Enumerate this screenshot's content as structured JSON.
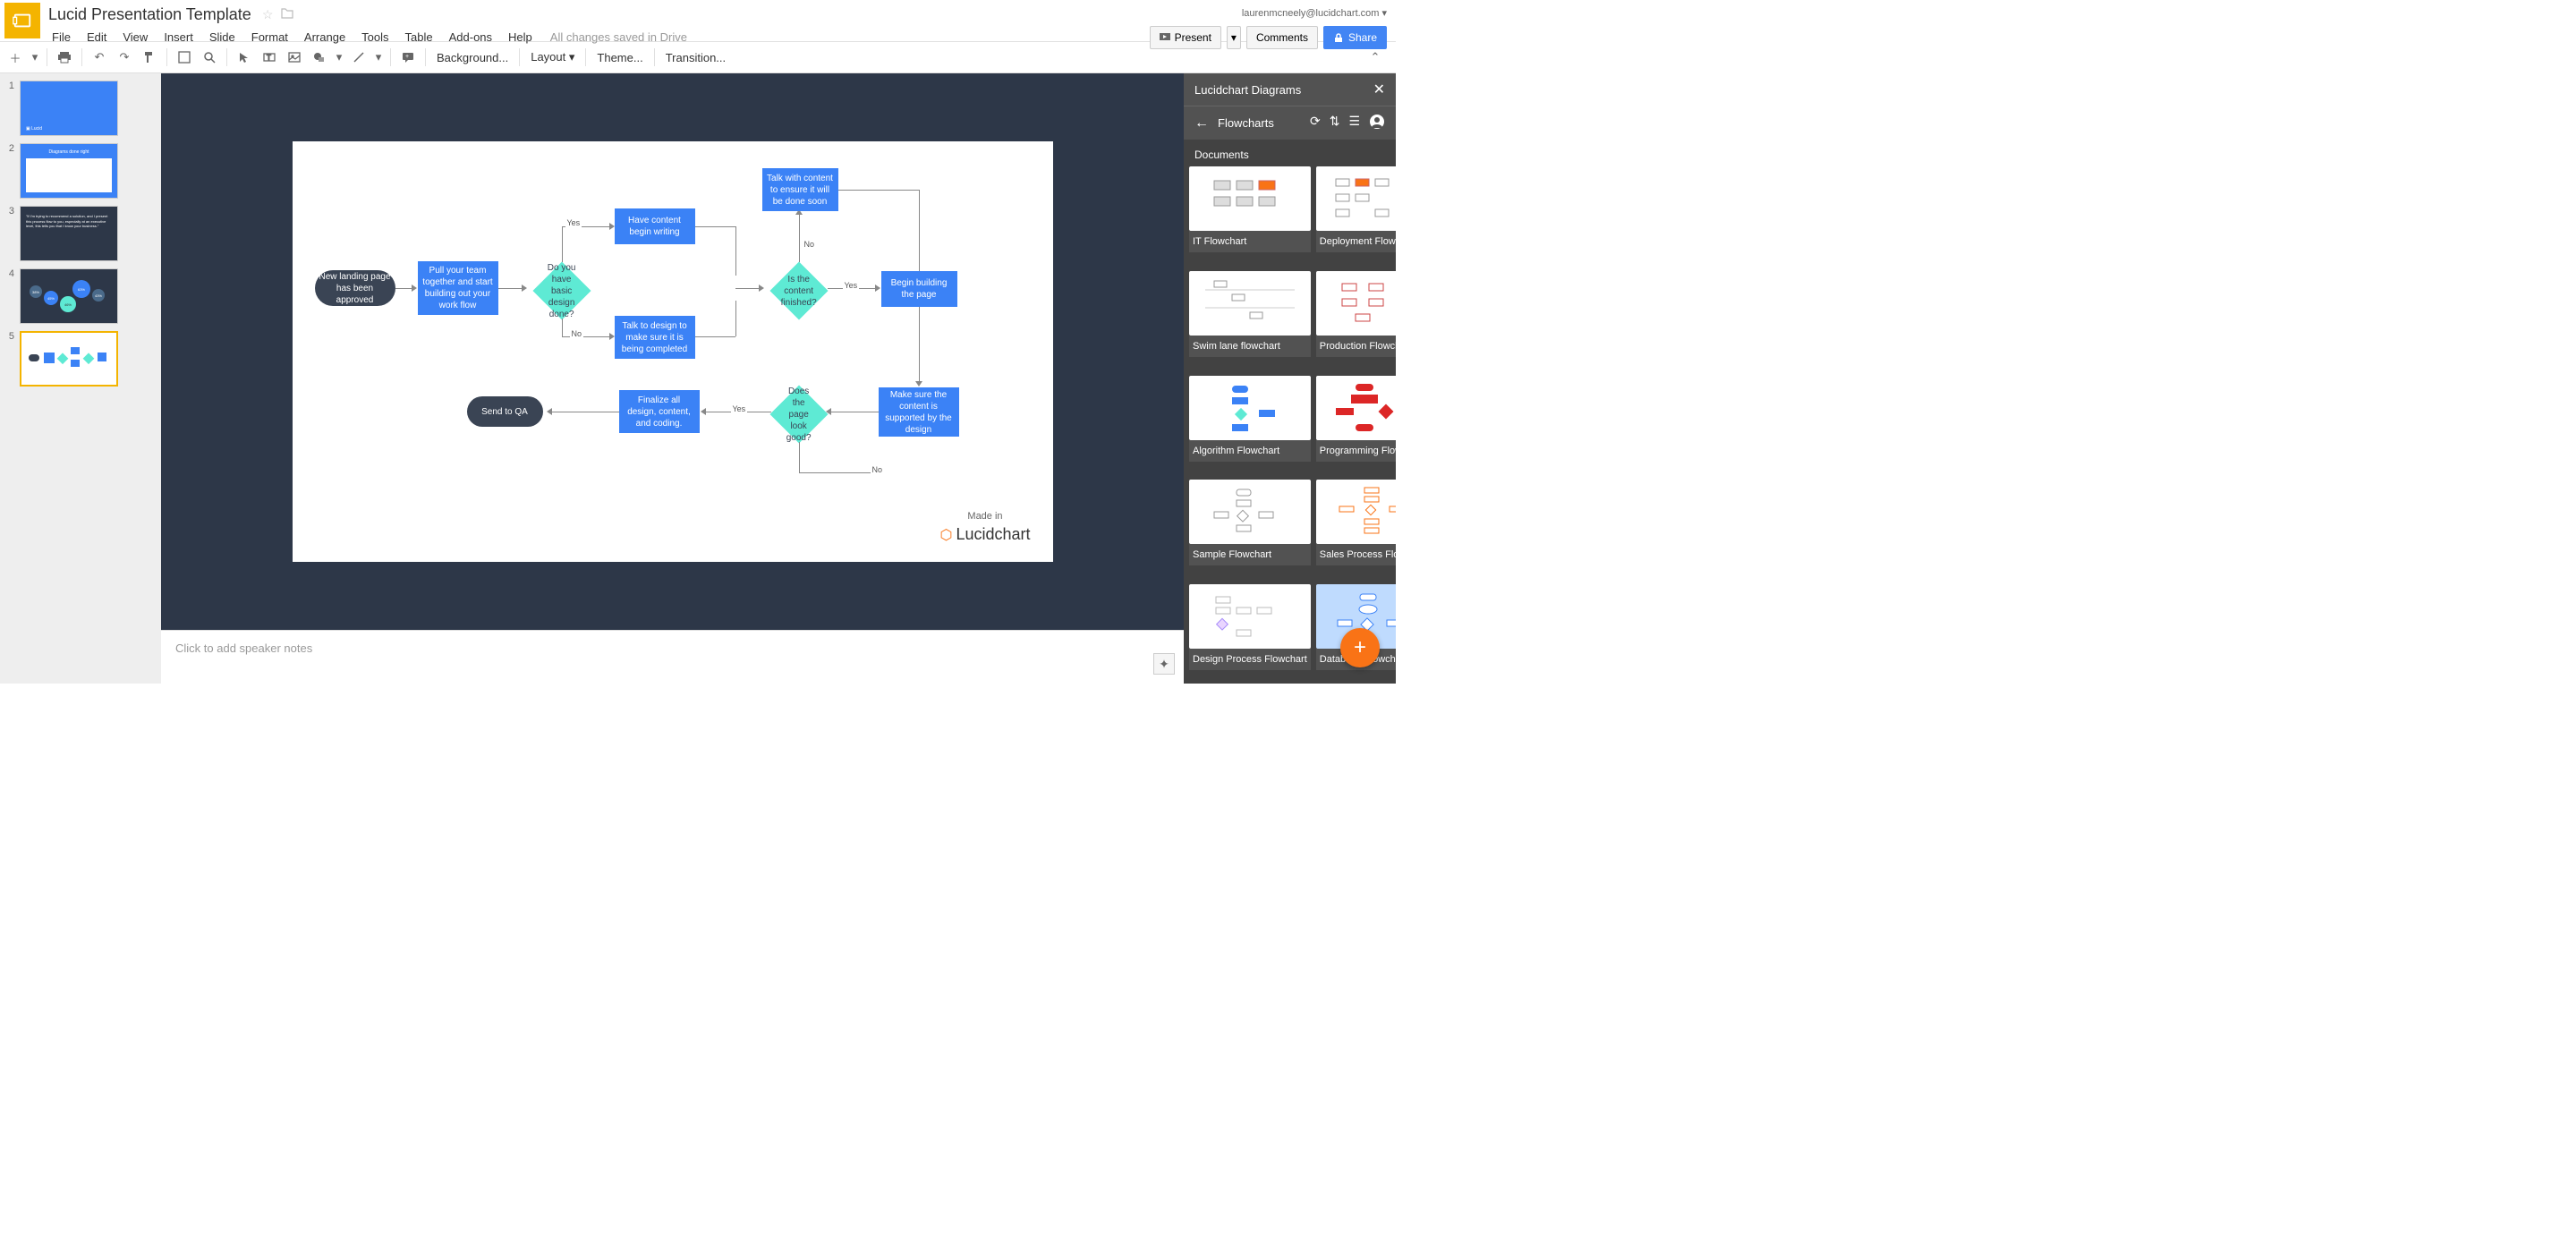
{
  "header": {
    "doc_title": "Lucid Presentation Template",
    "user_email": "laurenmcneely@lucidchart.com",
    "menus": [
      "File",
      "Edit",
      "View",
      "Insert",
      "Slide",
      "Format",
      "Arrange",
      "Tools",
      "Table",
      "Add-ons",
      "Help"
    ],
    "save_status": "All changes saved in Drive",
    "present_label": "Present",
    "comments_label": "Comments",
    "share_label": "Share"
  },
  "toolbar": {
    "background": "Background...",
    "layout": "Layout",
    "theme": "Theme...",
    "transition": "Transition..."
  },
  "slides": {
    "count": 5,
    "selected": 5,
    "thumb2_title": "Diagrams done right",
    "thumb3_quote": "\"If I'm trying to recommend a solution, and I present this process flow to you, especially at an executive level, this tells you that I know your business.\""
  },
  "flowchart": {
    "start": "New landing page has been approved",
    "pull_team": "Pull your team together and start building out your work flow",
    "basic_design": "Do you have basic design done?",
    "begin_writing": "Have content begin writing",
    "talk_design": "Talk to design to make sure it is being completed",
    "talk_content": "Talk with content to ensure it will be done soon",
    "content_finished": "Is the content finished?",
    "begin_building": "Begin building the page",
    "supported": "Make sure the content is supported by the design",
    "look_good": "Does the page look good?",
    "finalize": "Finalize all design, content, and coding.",
    "send_qa": "Send to QA",
    "yes": "Yes",
    "no": "No",
    "made_in": "Made in",
    "lucidchart": "Lucidchart"
  },
  "speaker_notes": {
    "placeholder": "Click to add speaker notes"
  },
  "sidebar": {
    "panel_title": "Lucidchart Diagrams",
    "nav_title": "Flowcharts",
    "section": "Documents",
    "docs": [
      "IT Flowchart",
      "Deployment Flowchart",
      "Swim lane flowchart",
      "Production Flowchart",
      "Algorithm Flowchart",
      "Programming Flowchart",
      "Sample Flowchart",
      "Sales Process Flowchart",
      "Design Process Flowchart",
      "Database Flowchart"
    ]
  }
}
